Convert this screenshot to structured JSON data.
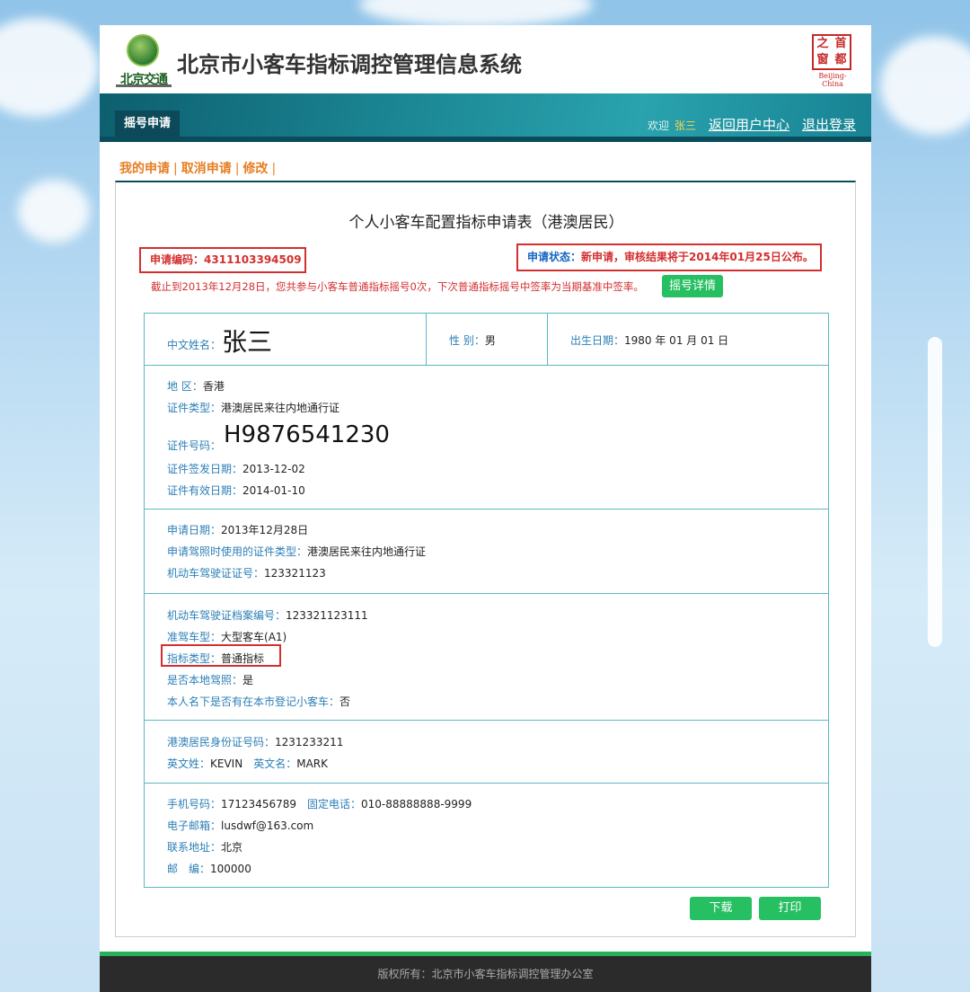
{
  "header": {
    "logo_text": "北京交通",
    "site_title": "北京市小客车指标调控管理信息系统",
    "seal_chars": [
      "之",
      "首",
      "窗",
      "都"
    ],
    "seal_caption": "Beijing-China"
  },
  "nav": {
    "tab": "摇号申请",
    "welcome": "欢迎",
    "username": "张三",
    "user_center": "返回用户中心",
    "logout": "退出登录"
  },
  "subnav": {
    "my_application": "我的申请",
    "cancel_application": "取消申请",
    "modify": "修改",
    "sep": "|"
  },
  "form": {
    "title": "个人小客车配置指标申请表（港澳居民）",
    "app_code_label": "申请编码：",
    "app_code": "4311103394509",
    "status_label": "申请状态：",
    "status_value": "新申请，审核结果将于2014年01月25日公布。",
    "notice": "截止到2013年12月28日，您共参与小客车普通指标摇号0次，下次普通指标摇号中签率为当期基准中签率。",
    "lottery_detail_button": "摇号详情"
  },
  "personal": {
    "name_label": "中文姓名：",
    "name": "张三",
    "gender_label": "性 别：",
    "gender": "男",
    "birth_label": "出生日期：",
    "birth": "1980 年 01 月 01 日"
  },
  "identity": {
    "region_label": "地 区：",
    "region": "香港",
    "id_type_label": "证件类型：",
    "id_type": "港澳居民来往内地通行证",
    "id_no_label": "证件号码：",
    "id_no": "H9876541230",
    "issue_label": "证件签发日期：",
    "issue": "2013-12-02",
    "valid_label": "证件有效日期：",
    "valid": "2014-01-10"
  },
  "application": {
    "date_label": "申请日期：",
    "date": "2013年12月28日",
    "license_id_type_label": "申请驾照时使用的证件类型：",
    "license_id_type": "港澳居民来往内地通行证",
    "license_no_label": "机动车驾驶证证号：",
    "license_no": "123321123"
  },
  "license": {
    "archive_label": "机动车驾驶证档案编号：",
    "archive": "123321123111",
    "class_label": "准驾车型：",
    "class": "大型客车(A1)",
    "quota_label": "指标类型：",
    "quota": "普通指标",
    "local_label": "是否本地驾照：",
    "local": "是",
    "owned_label": "本人名下是否有在本市登记小客车：",
    "owned": "否"
  },
  "hk": {
    "hkid_label": "港澳居民身份证号码：",
    "hkid": "1231233211",
    "surname_label": "英文姓：",
    "surname": "KEVIN",
    "given_label": "英文名：",
    "given": "MARK"
  },
  "contact": {
    "mobile_label": "手机号码：",
    "mobile": "17123456789",
    "phone_label": "固定电话：",
    "phone": "010-88888888-9999",
    "email_label": "电子邮箱：",
    "email": "lusdwf@163.com",
    "address_label": "联系地址：",
    "address": "北京",
    "zip_label": "邮　编：",
    "zip": "100000"
  },
  "actions": {
    "download": "下载",
    "print": "打印"
  },
  "footer": {
    "copyright": "版权所有：北京市小客车指标调控管理办公室"
  }
}
